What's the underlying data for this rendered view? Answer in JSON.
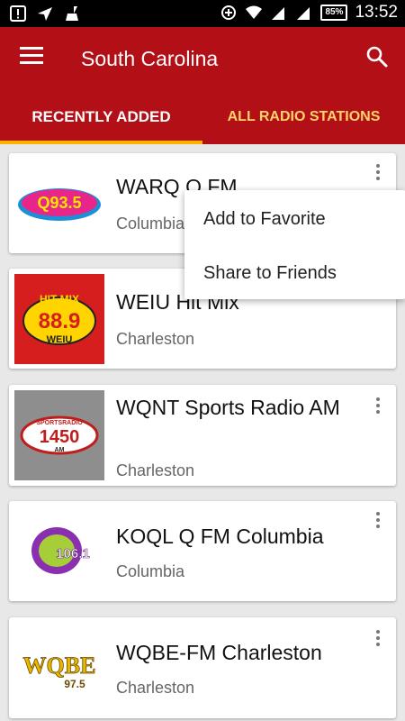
{
  "status_bar": {
    "time": "13:52",
    "battery": "85%",
    "signal_label": "2"
  },
  "app_bar": {
    "title": "South Carolina",
    "menu_icon": "hamburger-icon",
    "search_icon": "search-icon",
    "color": "#b20f17"
  },
  "tabs": [
    {
      "label": "RECENTLY ADDED",
      "active": true
    },
    {
      "label": "ALL RADIO STATIONS",
      "active": false
    }
  ],
  "stations": [
    {
      "name": "WARQ Q FM",
      "city": "Columbia",
      "logo_text": "Q93.5"
    },
    {
      "name": "WEIU Hit Mix",
      "city": "Charleston",
      "logo_text": "HIT-MIX 88.9 WEIU"
    },
    {
      "name": "WQNT Sports Radio AM",
      "city": "Charleston",
      "logo_text": "SPORTSRADIO 1450 AM"
    },
    {
      "name": "KOQL Q FM Columbia",
      "city": "Columbia",
      "logo_text": "Q106.1"
    },
    {
      "name": "WQBE-FM Charleston",
      "city": "Charleston",
      "logo_text": "WQBE 97.5"
    }
  ],
  "popup_menu": {
    "items": [
      "Add to Favorite",
      "Share to Friends"
    ]
  }
}
